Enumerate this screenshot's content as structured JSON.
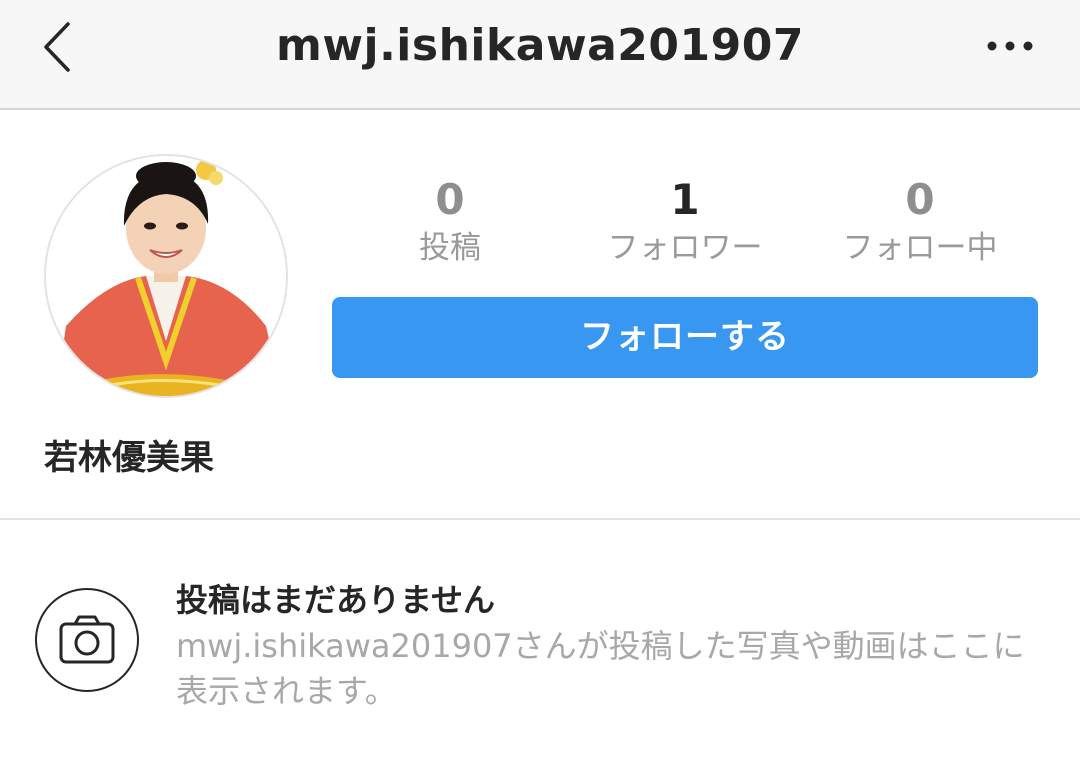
{
  "header": {
    "title": "mwj.ishikawa201907",
    "back_icon": "chevron-left-icon",
    "more_icon": "more-horizontal-icon"
  },
  "profile": {
    "display_name": "若林優美果",
    "stats": [
      {
        "value": "0",
        "label": "投稿"
      },
      {
        "value": "1",
        "label": "フォロワー"
      },
      {
        "value": "0",
        "label": "フォロー中"
      }
    ],
    "follow_button_label": "フォローする",
    "avatar_icon": "profile-photo"
  },
  "empty_state": {
    "icon": "camera-icon",
    "title": "投稿はまだありません",
    "description": "mwj.ishikawa201907さんが投稿した写真や動画はここに表示されます。"
  },
  "colors": {
    "accent": "#3897f0",
    "text": "#262626",
    "muted": "#a8a8a8"
  }
}
